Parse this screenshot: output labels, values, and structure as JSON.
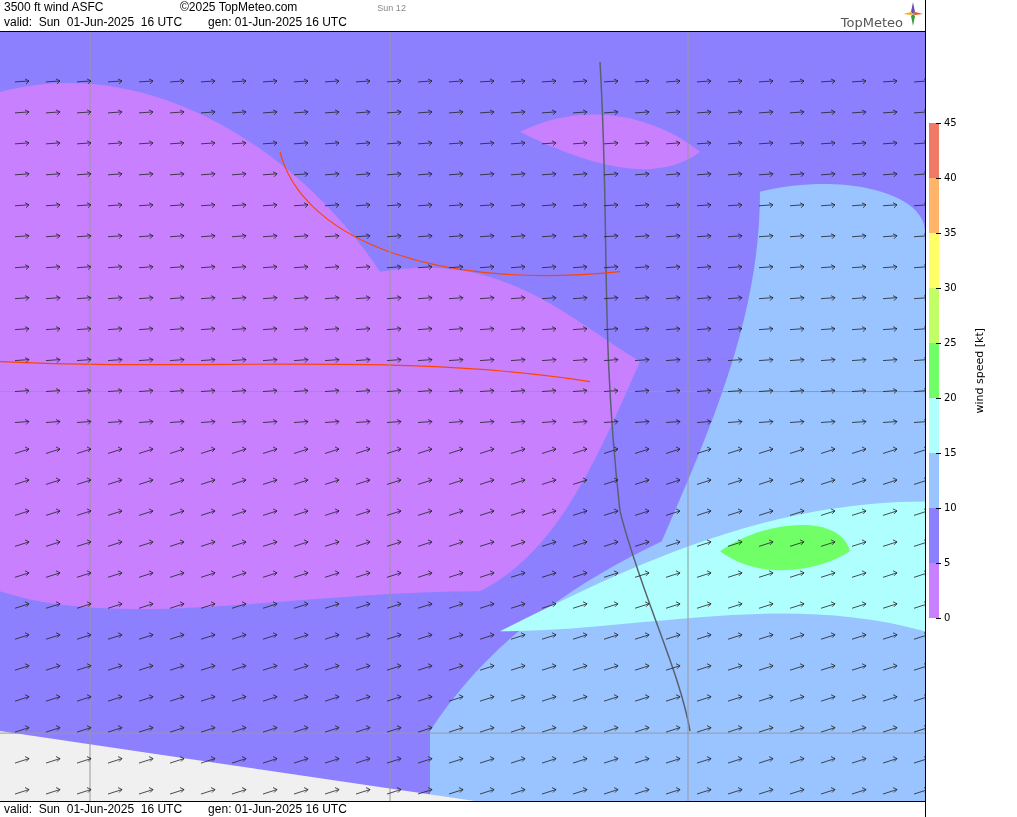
{
  "header": {
    "title": "3500 ft wind ASFC",
    "copyright": "©2025 TopMeteo.com",
    "run": "Sun 12",
    "valid": "valid:  Sun  01-Jun-2025  16 UTC",
    "generated": "gen: 01-Jun-2025 16 UTC",
    "logo": "TopMeteo"
  },
  "legend": {
    "title": "wind speed [kt]",
    "segments": [
      {
        "color": "#f07a66"
      },
      {
        "color": "#ffb469"
      },
      {
        "color": "#ffff66"
      },
      {
        "color": "#c2ff66"
      },
      {
        "color": "#70ff66"
      },
      {
        "color": "#b0ffff"
      },
      {
        "color": "#99c4ff"
      },
      {
        "color": "#8c80ff"
      },
      {
        "color": "#c880ff"
      }
    ],
    "ticks": [
      "45",
      "40",
      "35",
      "30",
      "25",
      "20",
      "15",
      "10",
      "5",
      "0"
    ]
  },
  "footer": {
    "valid": "valid:  Sun  01-Jun-2025  16 UTC",
    "generated": "gen: 01-Jun-2025 16 UTC"
  }
}
